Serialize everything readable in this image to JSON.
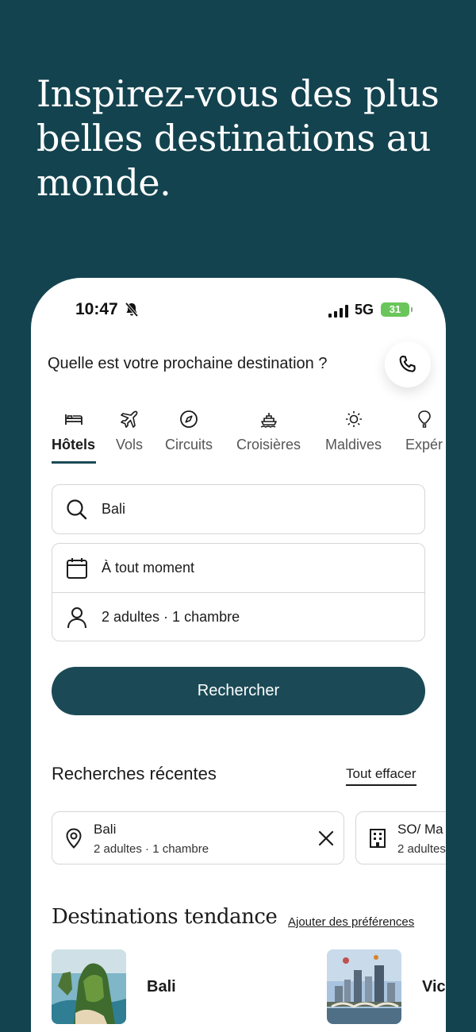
{
  "hero": {
    "title": "Inspirez-vous des plus belles destinations au monde."
  },
  "status_bar": {
    "time": "10:47",
    "network": "5G",
    "battery": "31"
  },
  "header": {
    "question": "Quelle est votre prochaine destination ?"
  },
  "tabs": [
    {
      "label": "Hôtels",
      "icon": "bed-icon",
      "active": true
    },
    {
      "label": "Vols",
      "icon": "plane-icon",
      "active": false
    },
    {
      "label": "Circuits",
      "icon": "compass-icon",
      "active": false
    },
    {
      "label": "Croisières",
      "icon": "ship-icon",
      "active": false
    },
    {
      "label": "Maldives",
      "icon": "sun-icon",
      "active": false
    },
    {
      "label": "Expér",
      "icon": "balloon-icon",
      "active": false
    }
  ],
  "search": {
    "destination_value": "Bali",
    "dates_value": "À tout moment",
    "guests_value": "2 adultes · 1 chambre",
    "button_label": "Rechercher"
  },
  "recent": {
    "title": "Recherches récentes",
    "clear_label": "Tout effacer",
    "items": [
      {
        "title": "Bali",
        "subtitle": "2 adultes · 1 chambre",
        "icon": "location-pin-icon"
      },
      {
        "title": "SO/ Ma",
        "subtitle": "2 adultes",
        "icon": "building-icon"
      }
    ]
  },
  "trending": {
    "title": "Destinations tendance",
    "preferences_label": "Ajouter des préférences",
    "items": [
      {
        "name": "Bali"
      },
      {
        "name": "Vic"
      }
    ]
  },
  "colors": {
    "brand": "#13434f",
    "button": "#1b4a56"
  }
}
